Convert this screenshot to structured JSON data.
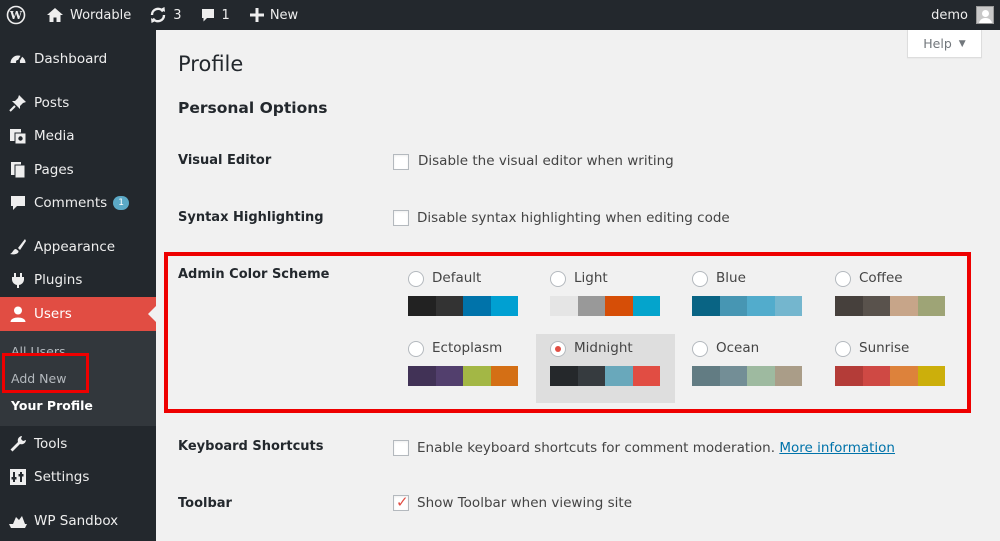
{
  "adminbar": {
    "site_name": "Wordable",
    "updates_count": "3",
    "comments_count": "1",
    "new_label": "New",
    "user_name": "demo"
  },
  "sidebar": {
    "items": [
      {
        "label": "Dashboard",
        "icon": "dashboard-icon"
      },
      {
        "label": "Posts",
        "icon": "pin-icon"
      },
      {
        "label": "Media",
        "icon": "media-icon"
      },
      {
        "label": "Pages",
        "icon": "pages-icon"
      },
      {
        "label": "Comments",
        "icon": "comment-icon",
        "badge": "1"
      },
      {
        "label": "Appearance",
        "icon": "brush-icon"
      },
      {
        "label": "Plugins",
        "icon": "plug-icon"
      },
      {
        "label": "Users",
        "icon": "user-icon"
      },
      {
        "label": "Tools",
        "icon": "wrench-icon"
      },
      {
        "label": "Settings",
        "icon": "settings-icon"
      },
      {
        "label": "WP Sandbox",
        "icon": "sandbox-icon"
      }
    ],
    "submenu": [
      "All Users",
      "Add New",
      "Your Profile"
    ]
  },
  "main": {
    "help_label": "Help",
    "title": "Profile",
    "section": "Personal Options",
    "visual_editor": {
      "label": "Visual Editor",
      "text": "Disable the visual editor when writing"
    },
    "syntax": {
      "label": "Syntax Highlighting",
      "text": "Disable syntax highlighting when editing code"
    },
    "color_scheme": {
      "label": "Admin Color Scheme",
      "selected": "Midnight",
      "schemes": [
        {
          "name": "Default",
          "colors": [
            "#222222",
            "#333333",
            "#0073aa",
            "#00a0d2"
          ]
        },
        {
          "name": "Light",
          "colors": [
            "#e5e5e5",
            "#999999",
            "#d64e07",
            "#04a4cc"
          ]
        },
        {
          "name": "Blue",
          "colors": [
            "#096484",
            "#4796b3",
            "#52accc",
            "#74b6ce"
          ]
        },
        {
          "name": "Coffee",
          "colors": [
            "#46403c",
            "#59524c",
            "#c7a589",
            "#9ea476"
          ]
        },
        {
          "name": "Ectoplasm",
          "colors": [
            "#413256",
            "#523f6d",
            "#a3b745",
            "#d46f15"
          ]
        },
        {
          "name": "Midnight",
          "colors": [
            "#25282b",
            "#363b3f",
            "#69a8bb",
            "#e14d43"
          ]
        },
        {
          "name": "Ocean",
          "colors": [
            "#627c83",
            "#738e96",
            "#9ebaa0",
            "#aa9d88"
          ]
        },
        {
          "name": "Sunrise",
          "colors": [
            "#b43c38",
            "#cf4944",
            "#dd823b",
            "#ccaf0b"
          ]
        }
      ]
    },
    "keyboard": {
      "label": "Keyboard Shortcuts",
      "text": "Enable keyboard shortcuts for comment moderation.",
      "link": "More information"
    },
    "toolbar": {
      "label": "Toolbar",
      "text": "Show Toolbar when viewing site"
    }
  },
  "colors": {
    "adminbar_bg": "#23282d",
    "active_menu": "#e14d43",
    "highlight": "#ee0000"
  }
}
